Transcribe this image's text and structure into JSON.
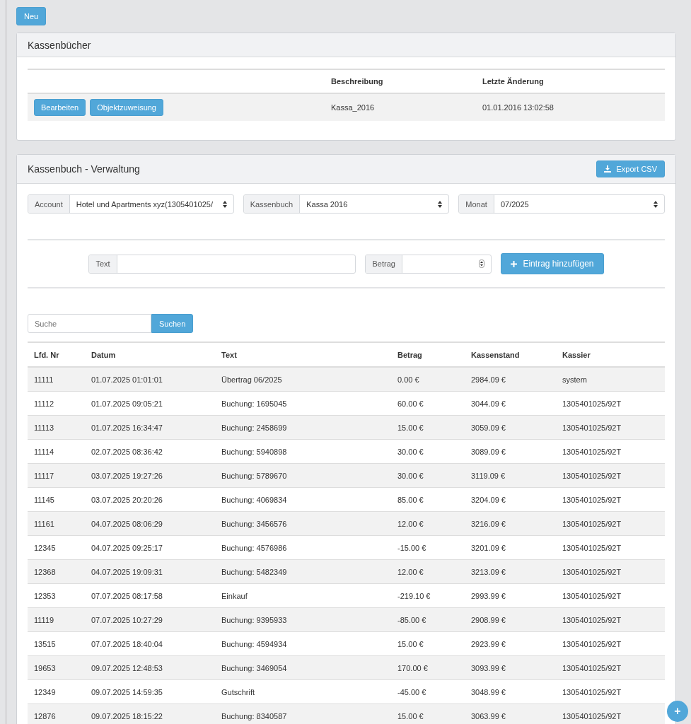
{
  "new_button": "Neu",
  "cashbooks": {
    "title": "Kassenbücher",
    "columns": [
      "Beschreibung",
      "Letzte Änderung"
    ],
    "rows": [
      {
        "actions": [
          "Bearbeiten",
          "Objektzuweisung"
        ],
        "description": "Kassa_2016",
        "changed": "01.01.2016 13:02:58"
      }
    ]
  },
  "management": {
    "title": "Kassenbuch - Verwaltung",
    "export_button": "Export CSV",
    "filters": [
      {
        "label": "Account",
        "value": "Hotel und Apartments xyz(1305401025/"
      },
      {
        "label": "Kassenbuch",
        "value": "Kassa 2016"
      },
      {
        "label": "Monat",
        "value": "07/2025"
      }
    ],
    "entry": {
      "text_label": "Text",
      "amount_label": "Betrag",
      "add_button": "Eintrag hinzufügen"
    },
    "search": {
      "placeholder": "Suche",
      "button": "Suchen"
    },
    "table": {
      "columns": [
        "Lfd. Nr",
        "Datum",
        "Text",
        "Betrag",
        "Kassenstand",
        "Kassier"
      ],
      "rows": [
        [
          "11111",
          "01.07.2025 01:01:01",
          "Übertrag 06/2025",
          "0.00 €",
          "2984.09 €",
          "system"
        ],
        [
          "11112",
          "01.07.2025 09:05:21",
          "Buchung: 1695045",
          "60.00 €",
          "3044.09 €",
          "1305401025/92T"
        ],
        [
          "11113",
          "01.07.2025 16:34:47",
          "Buchung: 2458699",
          "15.00 €",
          "3059.09 €",
          "1305401025/92T"
        ],
        [
          "11114",
          "02.07.2025 08:36:42",
          "Buchung: 5940898",
          "30.00 €",
          "3089.09 €",
          "1305401025/92T"
        ],
        [
          "11117",
          "03.07.2025 19:27:26",
          "Buchung: 5789670",
          "30.00 €",
          "3119.09 €",
          "1305401025/92T"
        ],
        [
          "11145",
          "03.07.2025 20:20:26",
          "Buchung: 4069834",
          "85.00 €",
          "3204.09 €",
          "1305401025/92T"
        ],
        [
          "11161",
          "04.07.2025 08:06:29",
          "Buchung: 3456576",
          "12.00 €",
          "3216.09 €",
          "1305401025/92T"
        ],
        [
          "12345",
          "04.07.2025 09:25:17",
          "Buchung: 4576986",
          "-15.00 €",
          "3201.09 €",
          "1305401025/92T"
        ],
        [
          "12368",
          "04.07.2025 19:09:31",
          "Buchung: 5482349",
          "12.00 €",
          "3213.09 €",
          "1305401025/92T"
        ],
        [
          "12353",
          "07.07.2025 08:17:58",
          "Einkauf",
          "-219.10 €",
          "2993.99 €",
          "1305401025/92T"
        ],
        [
          "11119",
          "07.07.2025 10:27:29",
          "Buchung: 9395933",
          "-85.00 €",
          "2908.99 €",
          "1305401025/92T"
        ],
        [
          "13515",
          "07.07.2025 18:40:04",
          "Buchung: 4594934",
          "15.00 €",
          "2923.99 €",
          "1305401025/92T"
        ],
        [
          "19653",
          "09.07.2025 12:48:53",
          "Buchung: 3469054",
          "170.00 €",
          "3093.99 €",
          "1305401025/92T"
        ],
        [
          "12349",
          "09.07.2025 14:59:35",
          "Gutschrift",
          "-45.00 €",
          "3048.99 €",
          "1305401025/92T"
        ],
        [
          "12876",
          "09.07.2025 18:15:22",
          "Buchung: 8340587",
          "15.00 €",
          "3063.99 €",
          "1305401025/92T"
        ]
      ]
    }
  },
  "fab": "+"
}
